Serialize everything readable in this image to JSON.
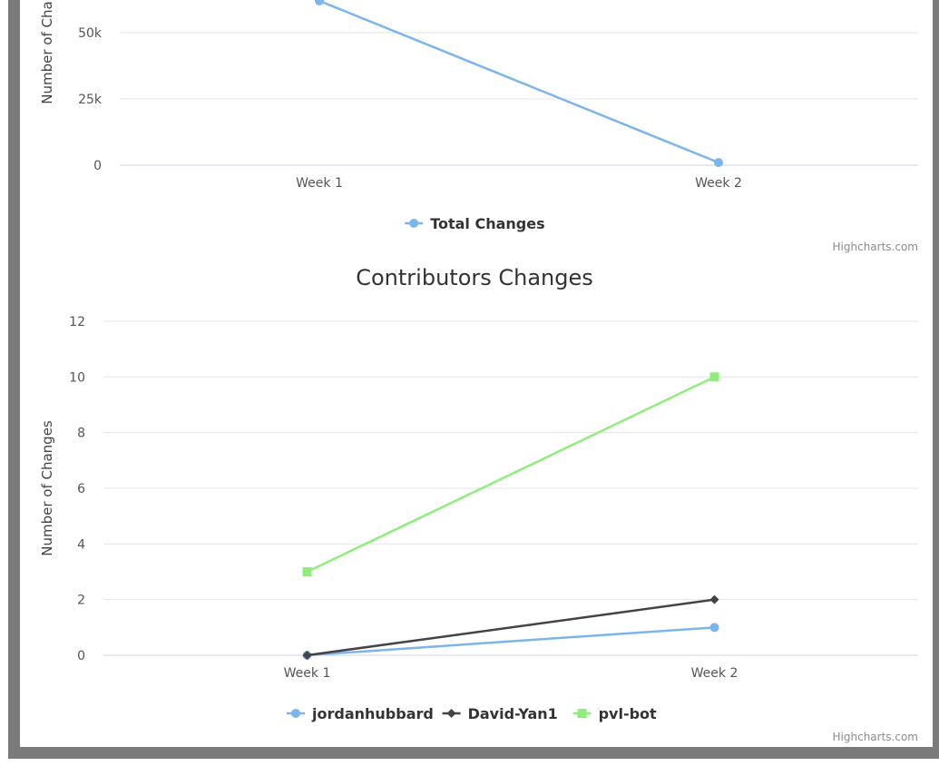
{
  "chart_data": [
    {
      "type": "line",
      "title": "",
      "ylabel": "Number of Changes",
      "categories": [
        "Week 1",
        "Week 2"
      ],
      "yticks": [
        "0",
        "25k",
        "50k"
      ],
      "ylim": [
        0,
        60000
      ],
      "series": [
        {
          "name": "Total Changes",
          "color": "#7cb5ec",
          "marker": "circle",
          "values": [
            62000,
            1000
          ]
        }
      ],
      "legend": "bottom-center",
      "credits": "Highcharts.com"
    },
    {
      "type": "line",
      "title": "Contributors Changes",
      "ylabel": "Number of Changes",
      "categories": [
        "Week 1",
        "Week 2"
      ],
      "yticks": [
        "0",
        "2",
        "4",
        "6",
        "8",
        "10",
        "12"
      ],
      "ylim": [
        0,
        12
      ],
      "series": [
        {
          "name": "jordanhubbard",
          "color": "#7cb5ec",
          "marker": "circle",
          "values": [
            0,
            1
          ]
        },
        {
          "name": "David-Yan1",
          "color": "#434348",
          "marker": "diamond",
          "values": [
            0,
            2
          ]
        },
        {
          "name": "pvl-bot",
          "color": "#90ed7d",
          "marker": "square",
          "values": [
            3,
            10
          ]
        }
      ],
      "legend": "bottom-center",
      "credits": "Highcharts.com"
    }
  ]
}
